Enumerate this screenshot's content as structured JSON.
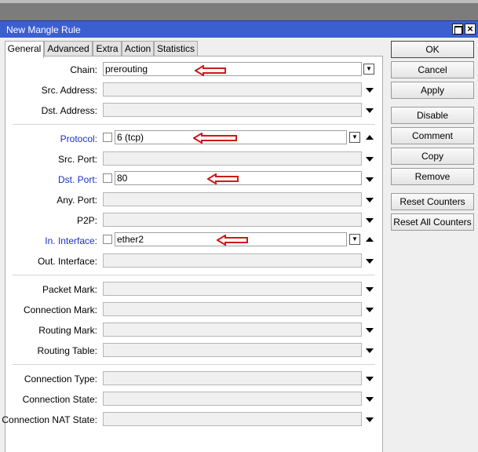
{
  "window": {
    "title": "New Mangle Rule"
  },
  "tabs": [
    "General",
    "Advanced",
    "Extra",
    "Action",
    "Statistics"
  ],
  "fields": {
    "chain": {
      "label": "Chain:",
      "value": "prerouting"
    },
    "src_address": {
      "label": "Src. Address:"
    },
    "dst_address": {
      "label": "Dst. Address:"
    },
    "protocol": {
      "label": "Protocol:",
      "value": "6 (tcp)"
    },
    "src_port": {
      "label": "Src. Port:"
    },
    "dst_port": {
      "label": "Dst. Port:",
      "value": "80"
    },
    "any_port": {
      "label": "Any. Port:"
    },
    "p2p": {
      "label": "P2P:"
    },
    "in_interface": {
      "label": "In. Interface:",
      "value": "ether2"
    },
    "out_interface": {
      "label": "Out. Interface:"
    },
    "packet_mark": {
      "label": "Packet Mark:"
    },
    "connection_mark": {
      "label": "Connection Mark:"
    },
    "routing_mark": {
      "label": "Routing Mark:"
    },
    "routing_table": {
      "label": "Routing Table:"
    },
    "connection_type": {
      "label": "Connection Type:"
    },
    "connection_state": {
      "label": "Connection State:"
    },
    "connection_nat_state": {
      "label": "Connection NAT State:"
    }
  },
  "buttons": {
    "ok": "OK",
    "cancel": "Cancel",
    "apply": "Apply",
    "disable": "Disable",
    "comment": "Comment",
    "copy": "Copy",
    "remove": "Remove",
    "reset_counters": "Reset Counters",
    "reset_all_counters": "Reset All Counters"
  },
  "colors": {
    "titlebar": "#3c5fd0",
    "highlight_label": "#1a2ec8",
    "annotation_arrow": "#d01818"
  },
  "icons": [
    "maximize-icon",
    "close-icon",
    "dropdown-arrow-icon",
    "collapse-up-icon",
    "annotation-arrow-icon"
  ]
}
